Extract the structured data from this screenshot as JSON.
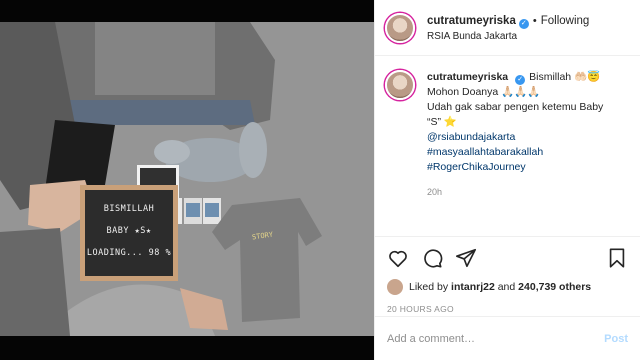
{
  "post": {
    "username": "cutratumeyriska",
    "separator": "•",
    "follow_label": "Following",
    "location": "RSIA Bunda Jakarta"
  },
  "caption": {
    "username": "cutratumeyriska",
    "line1": "Bismillah 🤲🏻😇",
    "line2": "Mohon Doanya 🙏🏻🙏🏻🙏🏻",
    "line3": "Udah gak sabar pengen ketemu Baby",
    "line4": "“S” ⭐",
    "tags": [
      "@rsiabundajakarta",
      "#masyaallahtabarakallah",
      "#RogerChikaJourney"
    ],
    "age": "20h"
  },
  "likes": {
    "prefix": "Liked by",
    "user": "intanrj22",
    "middle": "and",
    "count": "240,739 others"
  },
  "posted_time": "20 HOURS AGO",
  "comment_box": {
    "placeholder": "Add a comment…",
    "post_label": "Post"
  },
  "letterboard": {
    "line1": "BISMILLAH",
    "line2": "BABY ★S★",
    "line3": "LOADING... 98 %"
  },
  "onesie_text": "STORY",
  "colors": {
    "verified": "#3897f0",
    "link": "#00376b",
    "post_disabled": "#b3dbff",
    "meta_gray": "#8e8e8e"
  },
  "icons": [
    "heart-icon",
    "comment-icon",
    "share-icon",
    "bookmark-icon",
    "verified-icon"
  ]
}
